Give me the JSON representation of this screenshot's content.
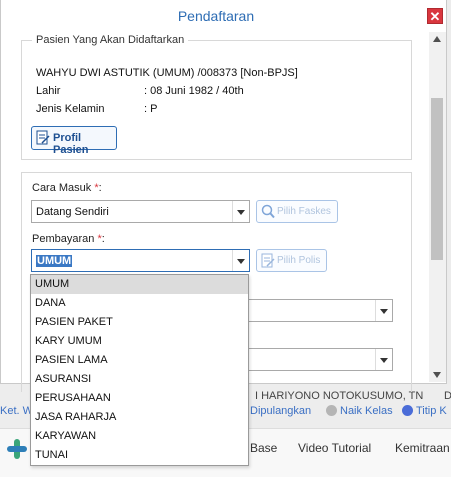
{
  "background": {
    "doctor_name_fragment": "I HARIYONO NOTOKUSUMO, TN",
    "doctor_trailing": "D",
    "legend": {
      "left_label": "Ket. W",
      "dipulangkan": "Dipulangkan",
      "naik_kelas": "Naik Kelas",
      "titip_kamar": "Titip K",
      "colors": {
        "dipulangkan": "#ffffff",
        "naik_kelas": "#b5b5b5",
        "titip_kamar": "#4a6cd8"
      }
    },
    "nav": {
      "item1": "Base",
      "item2": "Video Tutorial",
      "item3": "Kemitraan"
    }
  },
  "modal": {
    "title": "Pendaftaran",
    "close_symbol": "✕",
    "patient_section": {
      "legend": "Pasien Yang Akan Didaftarkan",
      "name_line": "WAHYU DWI ASTUTIK (UMUM) /008373 [Non-BPJS]",
      "lahir_label": "Lahir",
      "lahir_value": ": 08 Juni 1982 / 40th",
      "jk_label": "Jenis Kelamin",
      "jk_value": ": P",
      "profil_button": "Profil Pasien"
    },
    "form": {
      "cara_masuk_label": "Cara Masuk",
      "required_mark": "*",
      "colon": ":",
      "cara_masuk_value": "Datang Sendiri",
      "pilih_faskes": "Pilih Faskes",
      "pembayaran_label": "Pembayaran",
      "pembayaran_value": "UMUM",
      "pilih_polis": "Pilih Polis"
    },
    "dropdown_options": [
      "UMUM",
      "DANA",
      "PASIEN PAKET",
      "KARY UMUM",
      "PASIEN LAMA",
      "ASURANSI",
      "PERUSAHAAN",
      "JASA RAHARJA",
      "KARYAWAN",
      "TUNAI"
    ],
    "accent_color": "#2e6db4"
  }
}
